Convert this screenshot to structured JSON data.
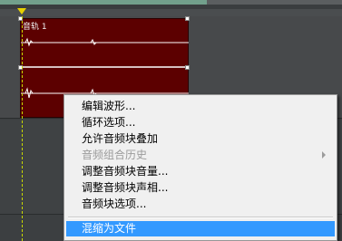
{
  "track": {
    "clip_label": "音轨 1",
    "clip_color": "#5c0000"
  },
  "context_menu": {
    "items": [
      {
        "label": "编辑波形...",
        "enabled": true
      },
      {
        "label": "循环选项...",
        "enabled": true
      },
      {
        "label": "允许音频块叠加",
        "enabled": true
      },
      {
        "label": "音频组合历史",
        "enabled": false,
        "submenu": true
      },
      {
        "label": "调整音频块音量...",
        "enabled": true
      },
      {
        "label": "调整音频块声相...",
        "enabled": true
      },
      {
        "label": "音频块选项...",
        "enabled": true
      },
      {
        "label": "混缩为文件",
        "enabled": true,
        "highlighted": true,
        "submenu": true
      }
    ]
  },
  "colors": {
    "highlight": "#3399ff",
    "playhead": "#e8d100"
  }
}
